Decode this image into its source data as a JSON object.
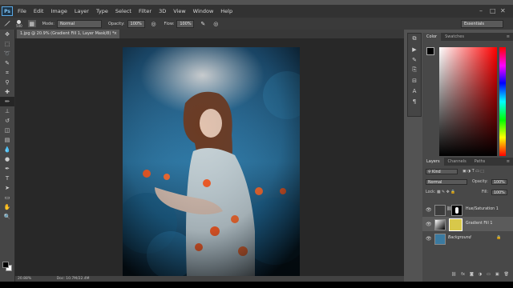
{
  "app": {
    "logo": "Ps",
    "menu": [
      "File",
      "Edit",
      "Image",
      "Layer",
      "Type",
      "Select",
      "Filter",
      "3D",
      "View",
      "Window",
      "Help"
    ],
    "window_controls": [
      "–",
      "□",
      "✕"
    ]
  },
  "options_bar": {
    "brush_size": "500",
    "mode_label": "Mode:",
    "mode_value": "Normal",
    "opacity_label": "Opacity:",
    "opacity_value": "100%",
    "flow_label": "Flow:",
    "flow_value": "100%",
    "workspace": "Essentials"
  },
  "document": {
    "tab_title": "1.jpg @ 20.9% (Gradient Fill 1, Layer Mask/8) *",
    "zoom": "20.88%",
    "doc_info": "Doc: 10.7M/22.4M"
  },
  "tools": [
    "move",
    "marquee",
    "lasso",
    "quick-select",
    "crop",
    "eyedropper",
    "healing",
    "brush",
    "clone-stamp",
    "history-brush",
    "eraser",
    "gradient",
    "blur",
    "dodge",
    "pen",
    "type",
    "path-select",
    "shape",
    "hand",
    "zoom"
  ],
  "panels": {
    "color_tabs": [
      "Color",
      "Swatches"
    ],
    "layers_tabs": [
      "Layers",
      "Channels",
      "Paths"
    ],
    "kind_label": "Kind",
    "blend_mode": "Normal",
    "opacity_label": "Opacity:",
    "opacity_value": "100%",
    "lock_label": "Lock:",
    "fill_label": "Fill:",
    "fill_value": "100%",
    "layers": [
      {
        "name": "Hue/Saturation 1",
        "selected": false
      },
      {
        "name": "Gradient Fill 1",
        "selected": true
      },
      {
        "name": "Background",
        "selected": false
      }
    ]
  },
  "colors": {
    "accent": "#2f9be8",
    "foreground": "#000000",
    "background_swatch": "#ffffff"
  }
}
